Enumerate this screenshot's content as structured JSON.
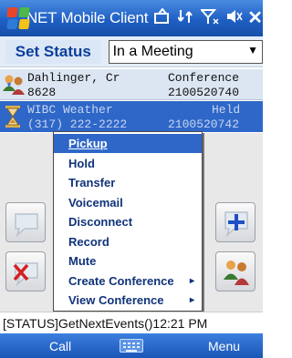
{
  "titlebar": {
    "title": ".NET Mobile Client",
    "icons": [
      "windows-logo-icon",
      "sync-icon",
      "network-icon",
      "signal-icon",
      "speaker-icon",
      "close-icon"
    ]
  },
  "status": {
    "button_label": "Set Status",
    "selected": "In a Meeting"
  },
  "calls": [
    {
      "name": "Dahlinger, Cr",
      "type": "Conference",
      "number": "8628",
      "extension": "2100520740",
      "icon": "conference-people-icon"
    },
    {
      "name": "WIBC Weather",
      "type": "Held",
      "number": "(317) 222-2222",
      "extension": "2100520742",
      "icon": "held-hourglass-icon"
    }
  ],
  "menu": {
    "items": [
      {
        "label": "Pickup",
        "selected": true
      },
      {
        "label": "Hold"
      },
      {
        "label": "Transfer"
      },
      {
        "label": "Voicemail"
      },
      {
        "label": "Disconnect"
      },
      {
        "label": "Record"
      },
      {
        "label": "Mute"
      },
      {
        "label": "Create Conference",
        "submenu": true
      },
      {
        "label": "View Conference",
        "submenu": true
      }
    ],
    "submenu_arrow": "▸"
  },
  "statusline": "[STATUS]GetNextEvents()12:21 PM",
  "softkeys": {
    "left": "Call",
    "right": "Menu"
  },
  "colors": {
    "titlebar": "#1f5fc4",
    "selection": "#2f67c8",
    "menu_text": "#10337a"
  }
}
